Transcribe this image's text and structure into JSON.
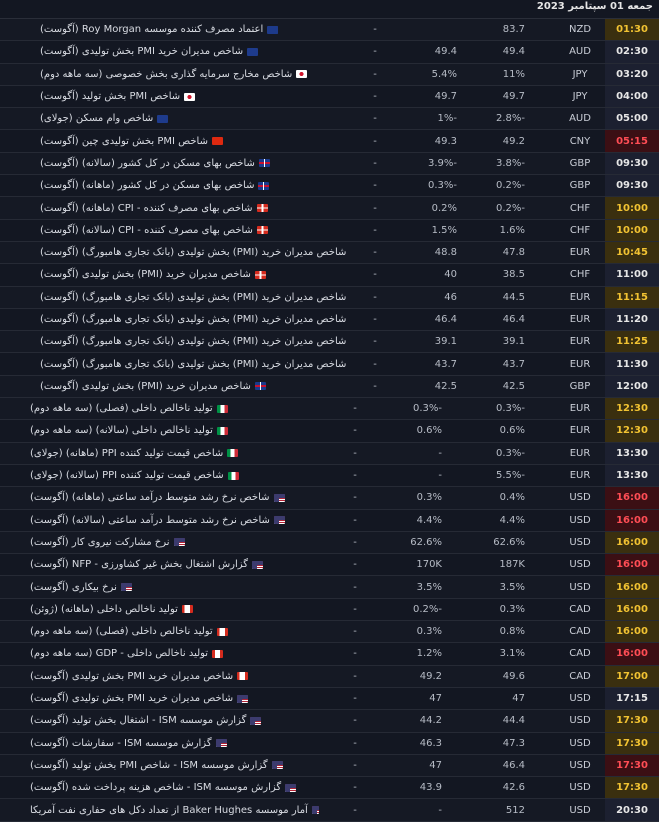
{
  "header": {
    "date": "جمعه 01 سپتامبر 2023"
  },
  "colors": {
    "gold_bg": "#3a2f0f",
    "red_bg": "#3b0f14",
    "gold_text": "#f1c232",
    "red_text": "#ff4d55"
  },
  "rows_a": [
    {
      "time": "01:30",
      "status": "gold",
      "cur": "NZD",
      "prev": "83.7",
      "fc": "",
      "act": "-",
      "name": "اعتماد مصرف کننده موسسه Roy Morgan (آگوست)",
      "flag": "nz"
    },
    {
      "time": "02:30",
      "status": "dark",
      "cur": "AUD",
      "prev": "49.4",
      "fc": "49.4",
      "act": "-",
      "name": "شاخص مدیران خرید PMI بخش تولیدی (آگوست)",
      "flag": "au"
    },
    {
      "time": "03:20",
      "status": "dark",
      "cur": "JPY",
      "prev": "11%",
      "fc": "5.4%",
      "act": "-",
      "name": "شاخص مخارج سرمایه گذاری بخش خصوصی (سه ماهه دوم)",
      "flag": "jp"
    },
    {
      "time": "04:00",
      "status": "dark",
      "cur": "JPY",
      "prev": "49.7",
      "fc": "49.7",
      "act": "-",
      "name": "شاخص PMI بخش تولید (آگوست)",
      "flag": "jp"
    },
    {
      "time": "05:00",
      "status": "dark",
      "cur": "AUD",
      "prev": "2.8%-",
      "fc": "1%-",
      "act": "-",
      "name": "شاخص وام مسکن (جولای)",
      "flag": "au"
    },
    {
      "time": "05:15",
      "status": "red",
      "cur": "CNY",
      "prev": "49.2",
      "fc": "49.3",
      "act": "-",
      "name": "شاخص PMI بخش تولیدی چین (آگوست)",
      "flag": "cn"
    },
    {
      "time": "09:30",
      "status": "dark",
      "cur": "GBP",
      "prev": "3.8%-",
      "fc": "3.9%-",
      "act": "-",
      "name": "شاخص بهای مسکن در کل کشور (سالانه) (آگوست)",
      "flag": "gb"
    },
    {
      "time": "09:30",
      "status": "dark",
      "cur": "GBP",
      "prev": "0.2%-",
      "fc": "0.3%-",
      "act": "-",
      "name": "شاخص بهای مسکن در کل کشور (ماهانه) (آگوست)",
      "flag": "gb"
    },
    {
      "time": "10:00",
      "status": "gold",
      "cur": "CHF",
      "prev": "0.2%-",
      "fc": "0.2%",
      "act": "-",
      "name": "شاخص بهای مصرف کننده - CPI (ماهانه) (آگوست)",
      "flag": "ch"
    },
    {
      "time": "10:00",
      "status": "gold",
      "cur": "CHF",
      "prev": "1.6%",
      "fc": "1.5%",
      "act": "-",
      "name": "شاخص بهای مصرف کننده - CPI (سالانه) (آگوست)",
      "flag": "ch"
    },
    {
      "time": "10:45",
      "status": "gold",
      "cur": "EUR",
      "prev": "47.8",
      "fc": "48.8",
      "act": "-",
      "name": "شاخص مدیران خرید (PMI) بخش تولیدی (بانک تجاری هامبورگ) (آگوست)",
      "flag": "es"
    },
    {
      "time": "11:00",
      "status": "dark",
      "cur": "CHF",
      "prev": "38.5",
      "fc": "40",
      "act": "-",
      "name": "شاخص مدیران خرید (PMI) بخش تولیدی (آگوست)",
      "flag": "ch"
    },
    {
      "time": "11:15",
      "status": "gold",
      "cur": "EUR",
      "prev": "44.5",
      "fc": "46",
      "act": "-",
      "name": "شاخص مدیران خرید (PMI) بخش تولیدی (بانک تجاری هامبورگ) (آگوست)",
      "flag": "it"
    },
    {
      "time": "11:20",
      "status": "dark",
      "cur": "EUR",
      "prev": "46.4",
      "fc": "46.4",
      "act": "-",
      "name": "شاخص مدیران خرید (PMI) بخش تولیدی (بانک تجاری هامبورگ) (آگوست)",
      "flag": "fr"
    },
    {
      "time": "11:25",
      "status": "gold",
      "cur": "EUR",
      "prev": "39.1",
      "fc": "39.1",
      "act": "-",
      "name": "شاخص مدیران خرید (PMI) بخش تولیدی (بانک تجاری هامبورگ) (آگوست)",
      "flag": "de"
    },
    {
      "time": "11:30",
      "status": "dark",
      "cur": "EUR",
      "prev": "43.7",
      "fc": "43.7",
      "act": "-",
      "name": "شاخص مدیران خرید (PMI) بخش تولیدی (بانک تجاری هامبورگ) (آگوست)",
      "flag": "eu"
    },
    {
      "time": "12:00",
      "status": "dark",
      "cur": "GBP",
      "prev": "42.5",
      "fc": "42.5",
      "act": "-",
      "name": "شاخص مدیران خرید (PMI) بخش تولیدی (آگوست)",
      "flag": "gb"
    }
  ],
  "rows_b": [
    {
      "time": "12:30",
      "status": "gold",
      "cur": "EUR",
      "prev": "0.3%-",
      "fc": "0.3%-",
      "act": "-",
      "name": "تولید ناخالص داخلی (فصلی) (سه ماهه دوم)",
      "flag": "it"
    },
    {
      "time": "12:30",
      "status": "gold",
      "cur": "EUR",
      "prev": "0.6%",
      "fc": "0.6%",
      "act": "-",
      "name": "تولید ناخالص داخلی (سالانه) (سه ماهه دوم)",
      "flag": "it"
    },
    {
      "time": "13:30",
      "status": "dark",
      "cur": "EUR",
      "prev": "0.3%-",
      "fc": "-",
      "act": "-",
      "name": "شاخص قیمت تولید کننده PPI (ماهانه) (جولای)",
      "flag": "it"
    },
    {
      "time": "13:30",
      "status": "dark",
      "cur": "EUR",
      "prev": "5.5%-",
      "fc": "-",
      "act": "-",
      "name": "شاخص قیمت تولید کننده PPI (سالانه) (جولای)",
      "flag": "it"
    },
    {
      "time": "16:00",
      "status": "red",
      "cur": "USD",
      "prev": "0.4%",
      "fc": "0.3%",
      "act": "-",
      "name": "شاخص نرخ رشد متوسط درآمد ساعتی (ماهانه) (آگوست)",
      "flag": "us"
    },
    {
      "time": "16:00",
      "status": "red",
      "cur": "USD",
      "prev": "4.4%",
      "fc": "4.4%",
      "act": "-",
      "name": "شاخص نرخ رشد متوسط درآمد ساعتی (سالانه) (آگوست)",
      "flag": "us"
    },
    {
      "time": "16:00",
      "status": "gold",
      "cur": "USD",
      "prev": "62.6%",
      "fc": "62.6%",
      "act": "-",
      "name": "نرخ مشارکت نیروی کار (آگوست)",
      "flag": "us"
    },
    {
      "time": "16:00",
      "status": "red",
      "cur": "USD",
      "prev": "187K",
      "fc": "170K",
      "act": "-",
      "name": "گزارش اشتغال بخش غیر کشاورزی - NFP (آگوست)",
      "flag": "us"
    },
    {
      "time": "16:00",
      "status": "gold",
      "cur": "USD",
      "prev": "3.5%",
      "fc": "3.5%",
      "act": "-",
      "name": "نرخ بیکاری (آگوست)",
      "flag": "us"
    },
    {
      "time": "16:00",
      "status": "gold",
      "cur": "CAD",
      "prev": "0.3%",
      "fc": "0.2%-",
      "act": "-",
      "name": "تولید ناخالص داخلی (ماهانه) (ژوئن)",
      "flag": "ca"
    },
    {
      "time": "16:00",
      "status": "gold",
      "cur": "CAD",
      "prev": "0.8%",
      "fc": "0.3%",
      "act": "-",
      "name": "تولید ناخالص داخلی (فصلی) (سه ماهه دوم)",
      "flag": "ca"
    },
    {
      "time": "16:00",
      "status": "red",
      "cur": "CAD",
      "prev": "3.1%",
      "fc": "1.2%",
      "act": "-",
      "name": "تولید ناخالص داخلی - GDP (سه ماهه دوم)",
      "flag": "ca"
    },
    {
      "time": "17:00",
      "status": "gold",
      "cur": "CAD",
      "prev": "49.6",
      "fc": "49.2",
      "act": "-",
      "name": "شاخص مدیران خرید PMI بخش تولیدی (آگوست)",
      "flag": "ca"
    },
    {
      "time": "17:15",
      "status": "dark",
      "cur": "USD",
      "prev": "47",
      "fc": "47",
      "act": "-",
      "name": "شاخص مدیران خرید PMI بخش تولیدی (آگوست)",
      "flag": "us"
    },
    {
      "time": "17:30",
      "status": "gold",
      "cur": "USD",
      "prev": "44.4",
      "fc": "44.2",
      "act": "-",
      "name": "گزارش موسسه ISM - اشتغال بخش تولید (آگوست)",
      "flag": "us"
    },
    {
      "time": "17:30",
      "status": "gold",
      "cur": "USD",
      "prev": "47.3",
      "fc": "46.3",
      "act": "-",
      "name": "گزارش موسسه ISM - سفارشات (آگوست)",
      "flag": "us"
    },
    {
      "time": "17:30",
      "status": "red",
      "cur": "USD",
      "prev": "46.4",
      "fc": "47",
      "act": "-",
      "name": "گزارش موسسه ISM - شاخص PMI بخش تولید (آگوست)",
      "flag": "us"
    },
    {
      "time": "17:30",
      "status": "gold",
      "cur": "USD",
      "prev": "42.6",
      "fc": "43.9",
      "act": "-",
      "name": "گزارش موسسه ISM - شاخص هزینه پرداخت شده (آگوست)",
      "flag": "us"
    },
    {
      "time": "20:30",
      "status": "dark",
      "cur": "USD",
      "prev": "512",
      "fc": "-",
      "act": "-",
      "name": "آمار موسسه Baker Hughes از تعداد دکل های حفاری نفت آمریکا",
      "flag": "us"
    }
  ]
}
